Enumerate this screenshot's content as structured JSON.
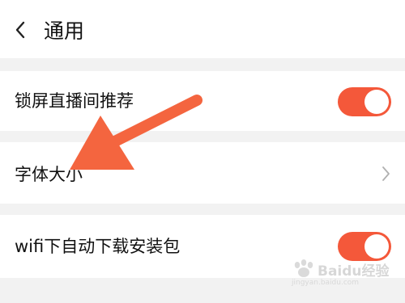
{
  "header": {
    "title": "通用",
    "back_icon": "chevron-left-icon"
  },
  "settings": {
    "live_recommend": {
      "label": "锁屏直播间推荐",
      "enabled": true
    },
    "font_size": {
      "label": "字体大小",
      "icon": "chevron-right-icon"
    },
    "wifi_download": {
      "label": "wifi下自动下载安装包",
      "enabled": true
    }
  },
  "colors": {
    "accent": "#f4583a",
    "background": "#f2f2f2",
    "row_background": "#ffffff"
  },
  "watermark": {
    "brand": "Baidu经验",
    "url": "jingyan.baidu.com"
  }
}
